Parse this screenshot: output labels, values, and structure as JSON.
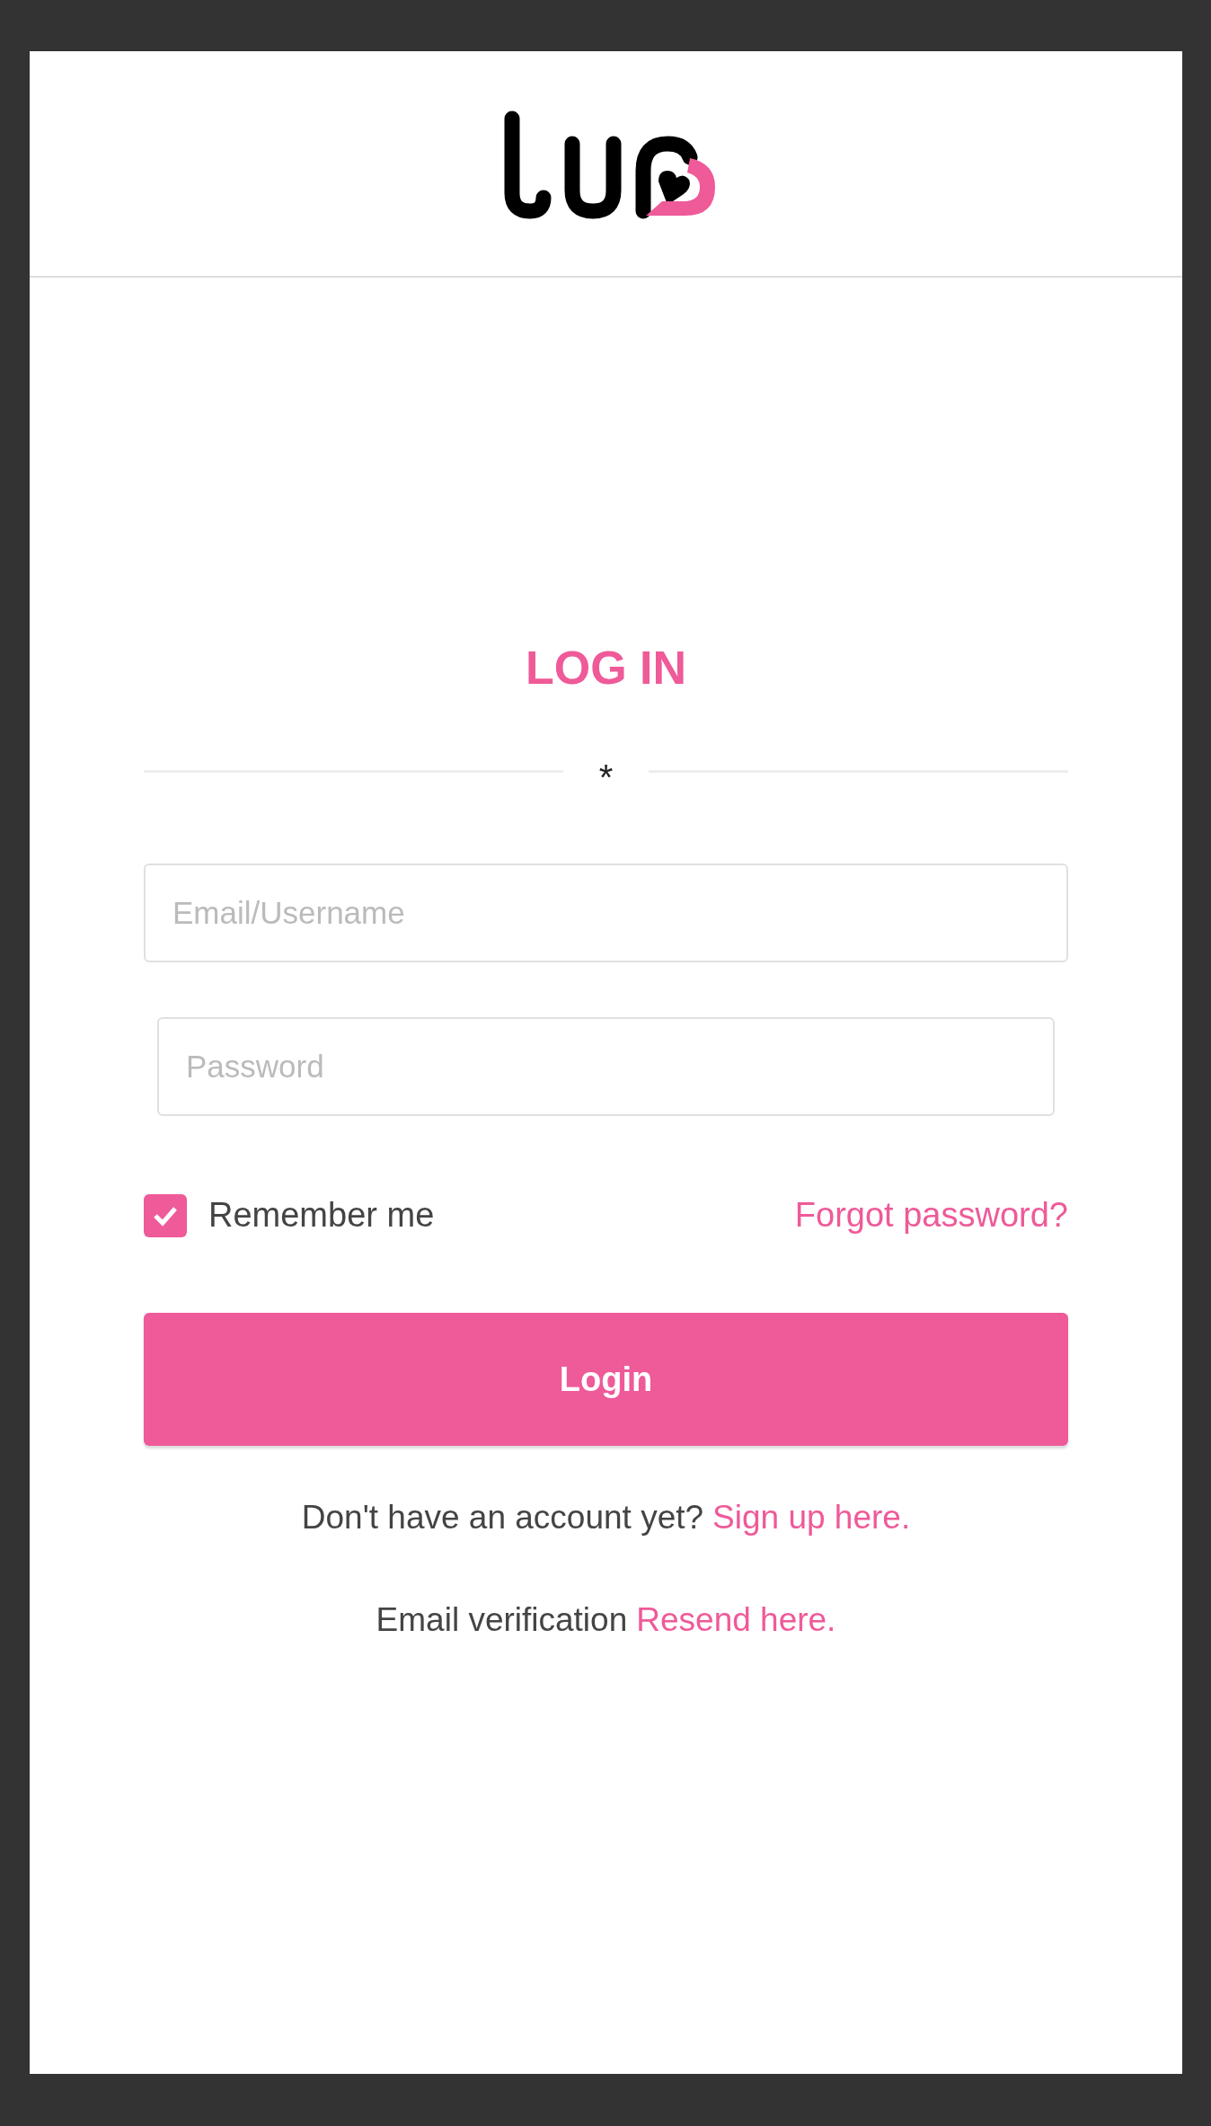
{
  "title": "LOG IN",
  "divider_mark": "*",
  "fields": [
    {
      "placeholder": "Email/Username"
    },
    {
      "placeholder": "Password"
    }
  ],
  "remember": {
    "label": "Remember me",
    "checked": true
  },
  "forgot_link": "Forgot password?",
  "login_button": "Login",
  "footer_lines": [
    {
      "text": "Don't have an account yet?",
      "link": "Sign up here."
    },
    {
      "text": "Email verification",
      "link": "Resend here."
    }
  ]
}
